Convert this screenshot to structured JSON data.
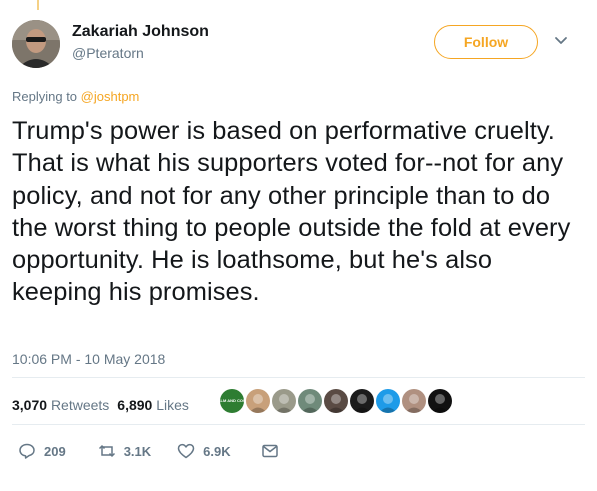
{
  "tweet": {
    "author": {
      "display_name": "Zakariah Johnson",
      "handle": "@Pteratorn"
    },
    "follow_label": "Follow",
    "replying_prefix": "Replying to ",
    "replying_to": "@joshtpm",
    "text": "Trump's power is based on performative cruelty. That is what his supporters voted for--not for any policy, and not for any other principle than to do the worst thing to people outside the fold at every opportunity. He is loathsome, but he's also keeping his promises.",
    "timestamp": "10:06 PM - 10 May 2018",
    "stats": {
      "retweets_count": "3,070",
      "retweets_label": "Retweets",
      "likes_count": "6,890",
      "likes_label": "Likes"
    },
    "likers_avatars": [
      {
        "kind": "keep-calm",
        "color": "#2e7d32",
        "text": "KEEP CALM AND COUP FEDIT"
      },
      {
        "kind": "photo",
        "color": "#c8a07a"
      },
      {
        "kind": "photo",
        "color": "#9a9a8a"
      },
      {
        "kind": "photo",
        "color": "#6f8a7a"
      },
      {
        "kind": "photo",
        "color": "#5a4b44"
      },
      {
        "kind": "photo",
        "color": "#1b1b1b"
      },
      {
        "kind": "photo",
        "color": "#1e9be8"
      },
      {
        "kind": "photo",
        "color": "#b09080"
      },
      {
        "kind": "photo",
        "color": "#111111"
      }
    ],
    "actions": {
      "replies": "209",
      "retweets": "3.1K",
      "likes": "6.9K"
    }
  },
  "colors": {
    "accent": "#f5a623",
    "muted": "#657786",
    "text": "#14171a",
    "divider": "#e6ecf0"
  }
}
